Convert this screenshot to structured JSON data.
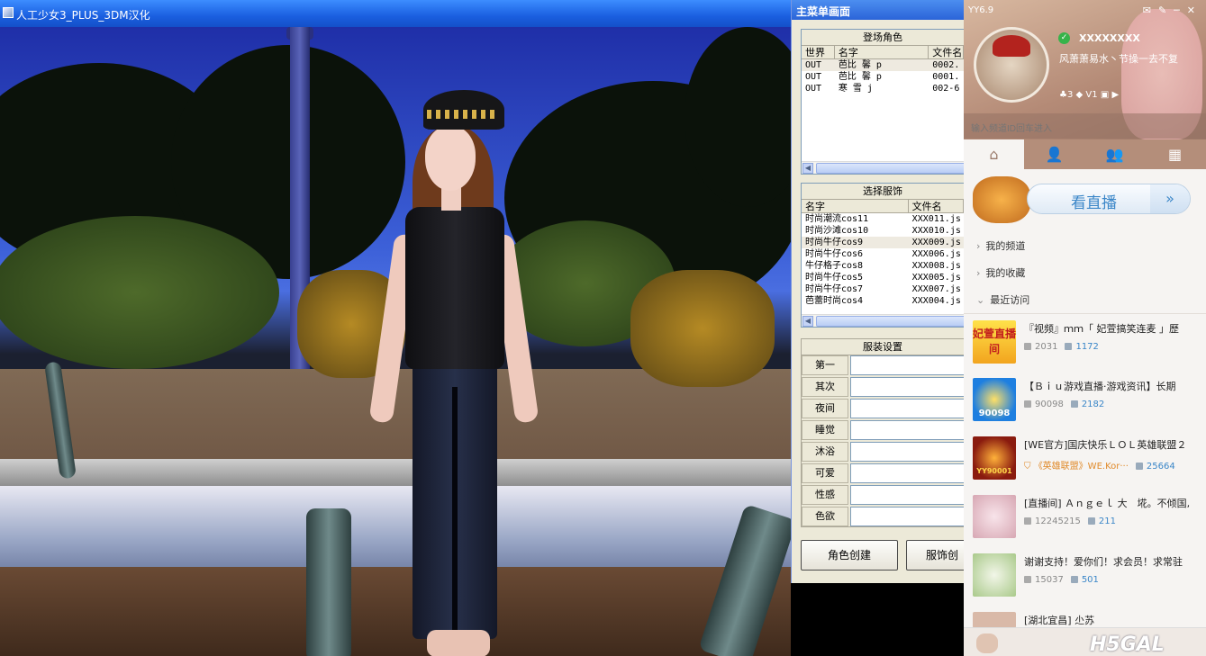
{
  "game": {
    "title": "人工少女3_PLUS_3DM汉化"
  },
  "menu": {
    "title": "主菜单画面",
    "characters": {
      "header": "登场角色",
      "columns": [
        "世界",
        "名字",
        "文件名"
      ],
      "rows": [
        {
          "world": "OUT",
          "name": "芭比 馨 p",
          "file": "0002."
        },
        {
          "world": "OUT",
          "name": "芭比 馨 p",
          "file": "0001."
        },
        {
          "world": "OUT",
          "name": "寒 雪 j",
          "file": "002-6"
        }
      ]
    },
    "outfits": {
      "header": "选择服饰",
      "columns": [
        "名字",
        "文件名"
      ],
      "rows": [
        {
          "name": "时尚潮流cos11",
          "file": "XXX011.js"
        },
        {
          "name": "时尚沙滩cos10",
          "file": "XXX010.js"
        },
        {
          "name": "时尚牛仔cos9",
          "file": "XXX009.js"
        },
        {
          "name": "时尚牛仔cos6",
          "file": "XXX006.js"
        },
        {
          "name": "牛仔格子cos8",
          "file": "XXX008.js"
        },
        {
          "name": "时尚牛仔cos5",
          "file": "XXX005.js"
        },
        {
          "name": "时尚牛仔cos7",
          "file": "XXX007.js"
        },
        {
          "name": "芭蕾时尚cos4",
          "file": "XXX004.js"
        }
      ]
    },
    "settings": {
      "header": "服装设置",
      "labels": [
        "第一",
        "其次",
        "夜间",
        "睡觉",
        "沐浴",
        "可爱",
        "性感",
        "色欲"
      ]
    },
    "buttons": {
      "create_character": "角色创建",
      "create_outfit": "服饰创"
    }
  },
  "yy": {
    "version": "YY6.9",
    "nickname": "XXXXXXXX",
    "signature": "风萧萧易水丶节操一去不复",
    "stats": {
      "a": "3",
      "b": "1"
    },
    "channel_placeholder": "输入频道ID回车进入",
    "watch_live": "看直播",
    "nav": [
      "我的频道",
      "我的收藏",
      "最近访问"
    ],
    "channels": [
      {
        "title": "『视频』ｍｍ「 妃萱搞笑连麦 」歷",
        "viewers": "2031",
        "online": "1172",
        "thumb_text": "妃萱直播间"
      },
      {
        "title": "【Ｂｉｕ游戏直播·游戏资讯】长期",
        "viewers": "90098",
        "online": "2182",
        "thumb_text": "90098"
      },
      {
        "title": "[WE官方]国庆快乐ＬＯＬ英雄联盟２",
        "tag": "《英雄联盟》WE.Kor···",
        "viewers": "",
        "online": "25664",
        "thumb_text": "YY90001"
      },
      {
        "title": "[直播间] Ａｎｇｅｌ 大　埖。不倾国,",
        "viewers": "12245215",
        "online": "211",
        "thumb_text": ""
      },
      {
        "title": "谢谢支持！爱你们！求会员！求常驻",
        "viewers": "15037",
        "online": "501",
        "thumb_text": ""
      },
      {
        "title": "[湖北宜昌] 尐苏",
        "viewers": "",
        "online": "",
        "thumb_text": ""
      }
    ],
    "watermark": "H5GAL"
  }
}
